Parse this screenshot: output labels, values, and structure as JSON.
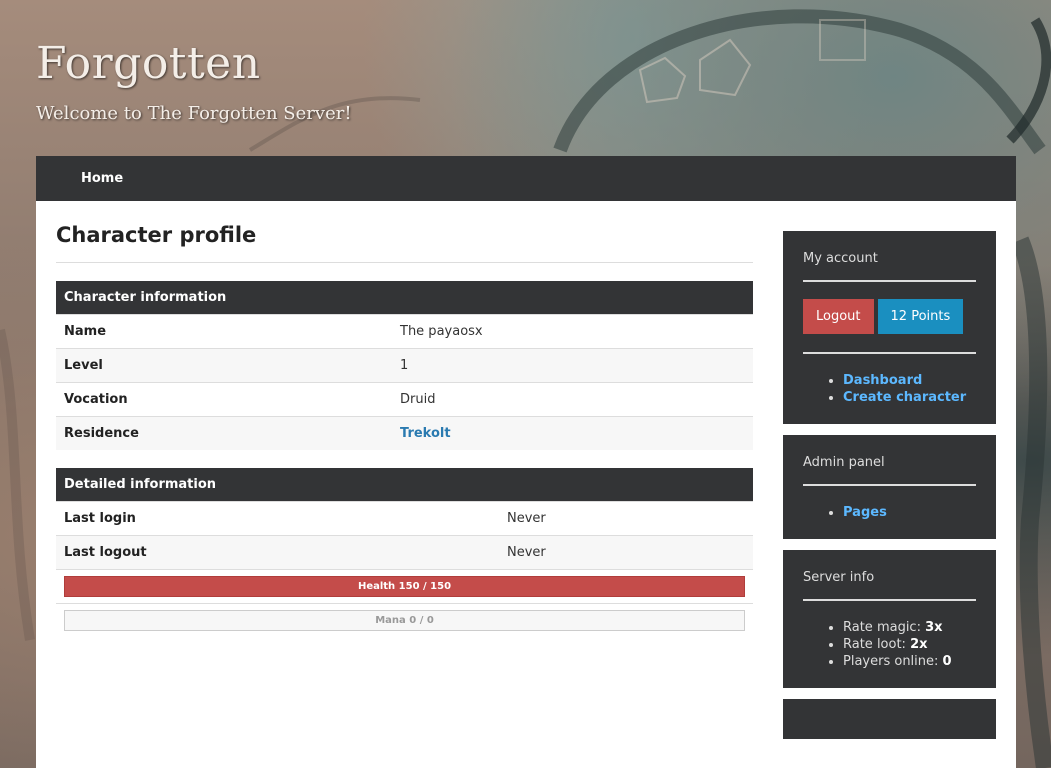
{
  "site": {
    "title": "Forgotten",
    "subtitle": "Welcome to The Forgotten Server!"
  },
  "nav": {
    "home_label": "Home"
  },
  "main": {
    "page_title": "Character profile",
    "character_info": {
      "header": "Character information",
      "rows": [
        {
          "label": "Name",
          "value": "The payaosx"
        },
        {
          "label": "Level",
          "value": "1"
        },
        {
          "label": "Vocation",
          "value": "Druid"
        },
        {
          "label": "Residence",
          "value": "Trekolt"
        }
      ]
    },
    "detailed_info": {
      "header": "Detailed information",
      "rows": [
        {
          "label": "Last login",
          "value": "Never"
        },
        {
          "label": "Last logout",
          "value": "Never"
        }
      ],
      "health_bar": {
        "text": "Health 150 / 150",
        "fraction": 1.0
      },
      "mana_bar": {
        "text": "Mana 0 / 0",
        "fraction": 0
      }
    }
  },
  "sidebar": {
    "account": {
      "title": "My account",
      "logout_label": "Logout",
      "points_label": "12 Points",
      "links": [
        "Dashboard",
        "Create character"
      ]
    },
    "admin": {
      "title": "Admin panel",
      "links": [
        "Pages"
      ]
    },
    "server": {
      "title": "Server info",
      "items": [
        {
          "label": "Rate magic: ",
          "value": "3x"
        },
        {
          "label": "Rate loot: ",
          "value": "2x"
        },
        {
          "label": "Players online: ",
          "value": "0"
        }
      ]
    }
  },
  "colors": {
    "dark_panel": "#333436",
    "danger": "#c44c4a",
    "info": "#1a8fc0",
    "link": "#5cb8ff"
  }
}
